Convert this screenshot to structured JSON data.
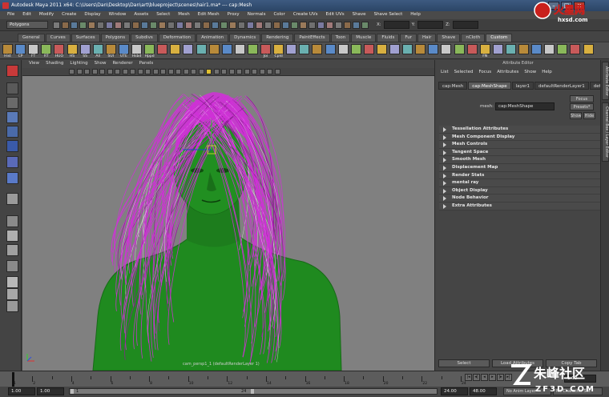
{
  "window": {
    "title": "Autodesk Maya 2011 x64: C:\\Users\\Dan\\Desktop\\Dan\\art\\blueproject\\scenes\\hair1.ma*   ---   cap:Mesh"
  },
  "menubar": [
    "File",
    "Edit",
    "Modify",
    "Create",
    "Display",
    "Window",
    "Assets",
    "Select",
    "Mesh",
    "Edit Mesh",
    "Proxy",
    "Normals",
    "Color",
    "Create UVs",
    "Edit UVs",
    "Shave",
    "Shave Select",
    "Help"
  ],
  "statusline": {
    "mode": "Polygons",
    "x_label": "X:",
    "y_label": "Y:",
    "z_label": "Z:"
  },
  "shelf": {
    "tabs": [
      "General",
      "Curves",
      "Surfaces",
      "Polygons",
      "Subdivs",
      "Deformation",
      "Animation",
      "Dynamics",
      "Rendering",
      "PaintEffects",
      "Toon",
      "Muscle",
      "Fluids",
      "Fur",
      "Hair",
      "Shave",
      "nCloth",
      "Custom"
    ],
    "active_tab": "Custom",
    "labels": [
      "Hist",
      "CP",
      "FT",
      "RT",
      "HUO",
      "HS",
      "SS",
      "All",
      "SUI",
      "UTE",
      "Hsbd",
      "Hppd",
      "",
      "",
      "",
      "",
      "",
      "",
      "",
      "",
      "Joi",
      "CpId",
      "",
      "",
      "",
      "",
      "",
      "",
      "",
      "",
      "",
      "",
      "",
      "",
      "",
      "",
      "",
      "FN",
      "",
      "",
      "",
      "",
      "",
      "",
      "",
      ""
    ]
  },
  "panel": {
    "menu": [
      "View",
      "Shading",
      "Lighting",
      "Show",
      "Renderer",
      "Panels"
    ],
    "camera_label": "cam_persp1_1 (defaultRenderLayer 1)"
  },
  "attribute_editor": {
    "title": "Attribute Editor",
    "menu": [
      "List",
      "Selected",
      "Focus",
      "Attributes",
      "Show",
      "Help"
    ],
    "tabs": [
      "cap:Mesh",
      "cap:MeshShape",
      "layer1",
      "defaultRenderLayer1",
      "defa"
    ],
    "active_tab": "cap:MeshShape",
    "mesh_label": "mesh:",
    "mesh_value": "cap:MeshShape",
    "buttons": {
      "focus": "Focus",
      "presets": "Presets*",
      "show": "Show",
      "hide": "Hide"
    },
    "sections": [
      "Tessellation Attributes",
      "Mesh Component Display",
      "Mesh Controls",
      "Tangent Space",
      "Smooth Mesh",
      "Displacement Map",
      "Render Stats",
      "mental ray",
      "Object Display",
      "Node Behavior",
      "Extra Attributes"
    ],
    "bottom_buttons": [
      "Select",
      "Load Attributes",
      "Copy Tab"
    ]
  },
  "side_tabs": [
    "Attribute Editor",
    "Channel Box / Layer Editor"
  ],
  "timeline": {
    "ticks": [
      "1",
      "2",
      "4",
      "6",
      "8",
      "10",
      "12",
      "14",
      "16",
      "18",
      "20",
      "22",
      "24"
    ],
    "current_frame": "1.00"
  },
  "range": {
    "start": "1.00",
    "start2": "1.00",
    "slider_start": "1",
    "slider_end": "24",
    "end": "24.00",
    "end2": "48.00",
    "anim_layer": "No Anim Layer",
    "char_set": "No Character Set"
  },
  "watermarks": {
    "top_right": "火星网",
    "top_right_sub": "hxsd.com",
    "bottom_right": "朱峰社区",
    "bottom_right_sub": "ZF3D.COM"
  },
  "colors": {
    "hair": "#d030d8",
    "mesh": "#1e8a1e",
    "viewport_bg": "#808080",
    "panel": "#444444"
  }
}
